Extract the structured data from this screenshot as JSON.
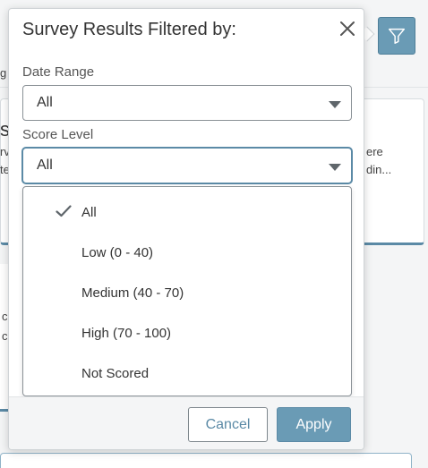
{
  "background": {
    "fragments": [
      {
        "id": "bg-frag-g",
        "text": "g"
      },
      {
        "id": "bg-frag-s",
        "text": "s"
      },
      {
        "id": "bg-frag-rv",
        "text": "rv"
      },
      {
        "id": "bg-frag-te",
        "text": "te"
      },
      {
        "id": "bg-frag-ere",
        "text": "ere"
      },
      {
        "id": "bg-frag-din",
        "text": "din..."
      },
      {
        "id": "bg-frag-c1",
        "text": "c"
      },
      {
        "id": "bg-frag-c2",
        "text": "c"
      }
    ]
  },
  "filter_button": {
    "icon": "filter-icon"
  },
  "popover": {
    "title": "Survey Results Filtered by:",
    "close_icon": "close-icon",
    "date_range": {
      "label": "Date Range",
      "value": "All"
    },
    "score_level": {
      "label": "Score Level",
      "value": "All",
      "options": [
        {
          "label": "All",
          "selected": true
        },
        {
          "label": "Low (0 - 40)",
          "selected": false
        },
        {
          "label": "Medium (40 - 70)",
          "selected": false
        },
        {
          "label": "High (70 - 100)",
          "selected": false
        },
        {
          "label": "Not Scored",
          "selected": false
        }
      ]
    },
    "buttons": {
      "cancel": "Cancel",
      "apply": "Apply"
    }
  },
  "colors": {
    "accent": "#6a9bb5",
    "accent_dark": "#5b8aa6",
    "border": "#8a9196",
    "footer_bg": "#f4f5f6"
  }
}
